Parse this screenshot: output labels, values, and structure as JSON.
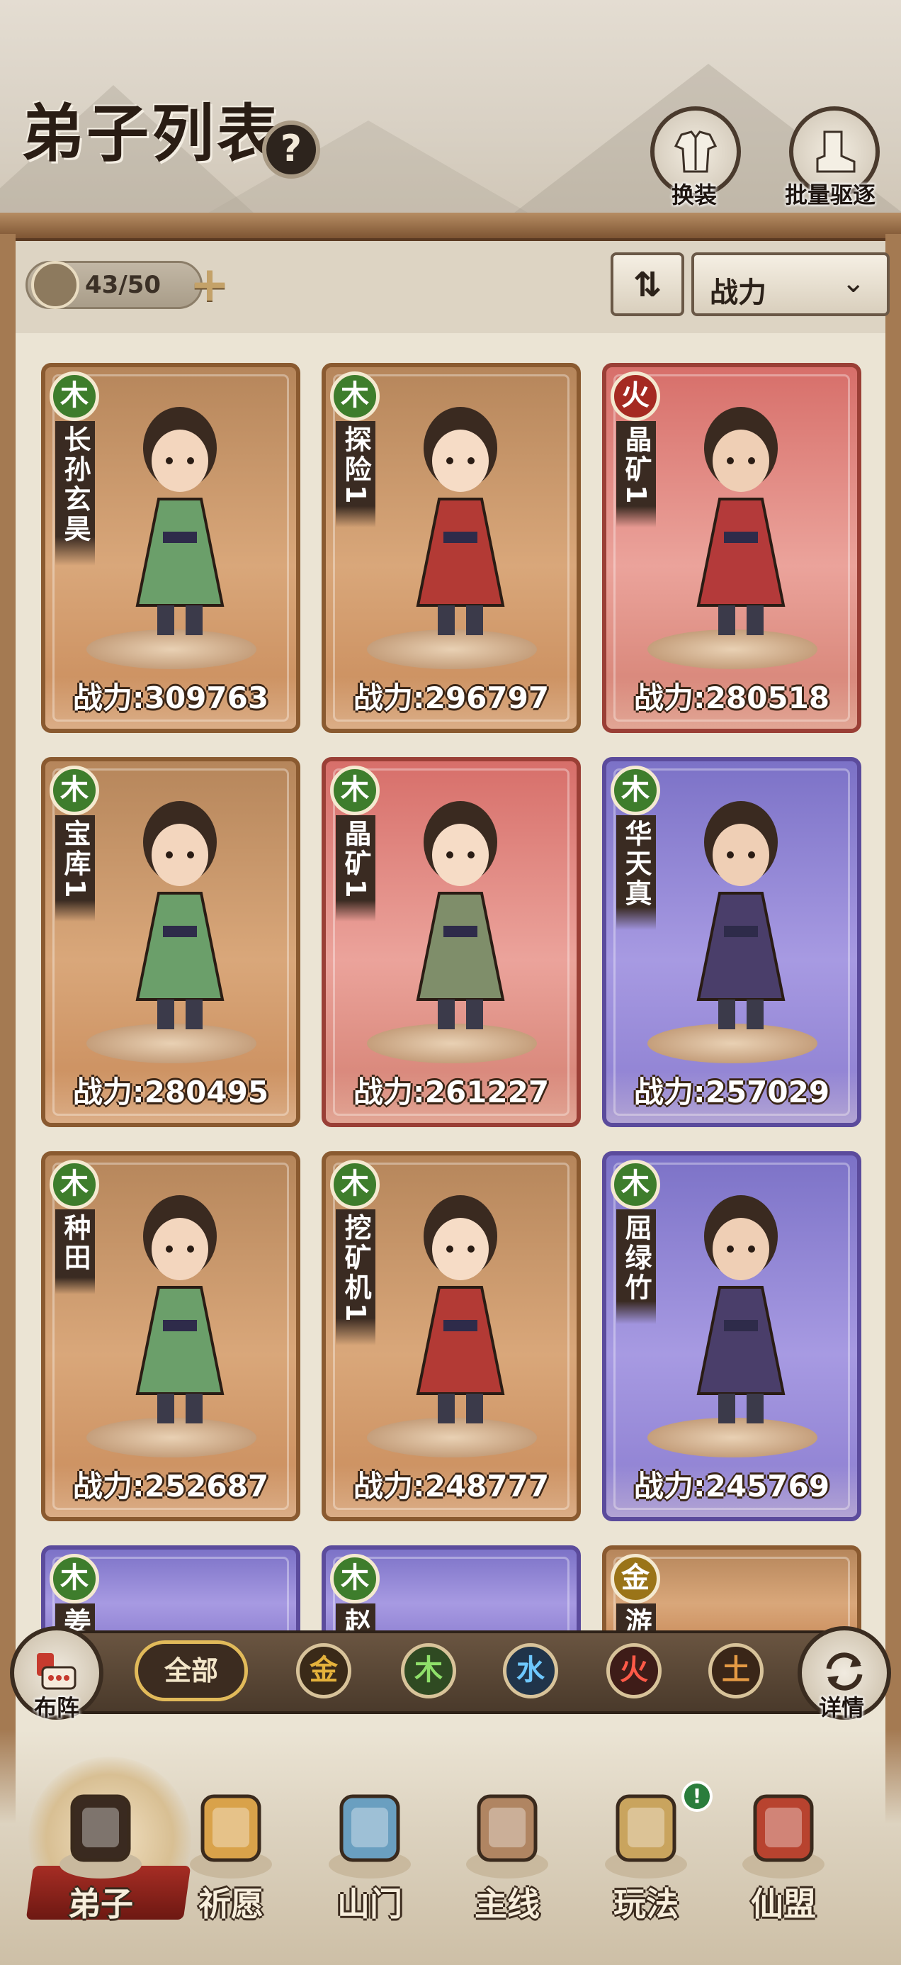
{
  "header": {
    "title": "弟子列表",
    "help_icon": "question-icon",
    "buttons": [
      {
        "label": "换装",
        "icon": "outfit-icon"
      },
      {
        "label": "批量驱逐",
        "icon": "boot-icon"
      }
    ]
  },
  "toolbar": {
    "disciple_count": "43/50",
    "sort_toggle_icon": "sort-arrows-icon",
    "sort_by": "战力",
    "sort_caret_icon": "chevron-down-icon"
  },
  "disciples": [
    {
      "element": "木",
      "name": "长孙玄昊",
      "power": "战力:309763",
      "bg": "orange"
    },
    {
      "element": "木",
      "name": "探险1",
      "power": "战力:296797",
      "bg": "orange"
    },
    {
      "element": "火",
      "name": "晶矿1",
      "power": "战力:280518",
      "bg": "red"
    },
    {
      "element": "木",
      "name": "宝库1",
      "power": "战力:280495",
      "bg": "orange"
    },
    {
      "element": "木",
      "name": "晶矿1",
      "power": "战力:261227",
      "bg": "red"
    },
    {
      "element": "木",
      "name": "华天真",
      "power": "战力:257029",
      "bg": "purple"
    },
    {
      "element": "木",
      "name": "种田",
      "power": "战力:252687",
      "bg": "orange"
    },
    {
      "element": "木",
      "name": "挖矿机1",
      "power": "战力:248777",
      "bg": "orange"
    },
    {
      "element": "木",
      "name": "屈绿竹",
      "power": "战力:245769",
      "bg": "purple"
    },
    {
      "element": "木",
      "name": "姜",
      "bg": "purple"
    },
    {
      "element": "木",
      "name": "赵",
      "bg": "purple"
    },
    {
      "element": "金",
      "name": "游",
      "bg": "orange"
    }
  ],
  "filter": {
    "left_button": "布阵",
    "all_label": "全部",
    "elements": [
      "金",
      "木",
      "水",
      "火",
      "土"
    ],
    "right_button": "详情"
  },
  "nav": {
    "items": [
      {
        "label": "弟子",
        "icon": "disciple-icon",
        "active": true
      },
      {
        "label": "祈愿",
        "icon": "scroll-icon"
      },
      {
        "label": "山门",
        "icon": "gate-icon"
      },
      {
        "label": "主线",
        "icon": "sword-icon"
      },
      {
        "label": "玩法",
        "icon": "map-icon",
        "badge": "!"
      },
      {
        "label": "仙盟",
        "icon": "banner-icon"
      }
    ]
  },
  "colors": {
    "wood": "#3e7d2c",
    "fire": "#a52a22",
    "gold": "#9a7418",
    "card_orange": "#c88a59",
    "card_red": "#d76f6a",
    "card_purple": "#8a7ccf"
  }
}
